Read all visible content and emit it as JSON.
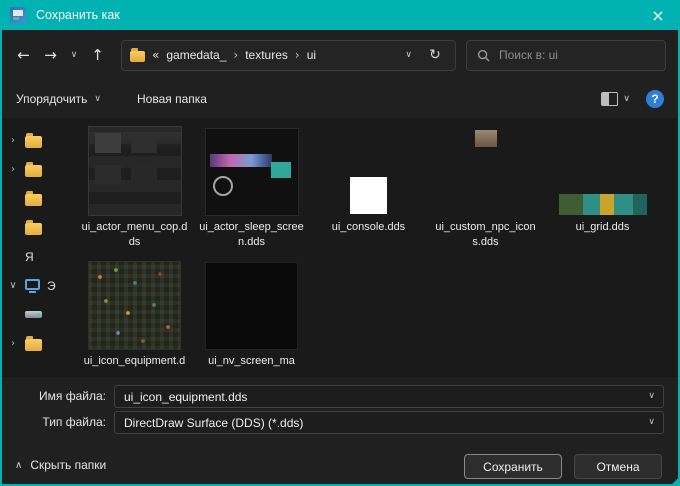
{
  "window": {
    "title": "Сохранить как"
  },
  "glyphs": {
    "close": "×",
    "back": "←",
    "forward": "→",
    "up": "↑",
    "chevron_down": "∨",
    "chevron_right": "›",
    "chevron_up": "∧",
    "overflow": "«",
    "refresh": "↻",
    "help": "?"
  },
  "nav": {
    "breadcrumb": {
      "crumbs": [
        "gamedata_",
        "textures",
        "ui"
      ],
      "separator": "›"
    },
    "search_placeholder": "Поиск в: ui"
  },
  "toolbar": {
    "organize_label": "Упорядочить",
    "new_folder_label": "Новая папка"
  },
  "sidebar": {
    "labels": {
      "ya": "Я",
      "e": "Э"
    }
  },
  "files": [
    {
      "name": "ui_actor_menu_cop.dds"
    },
    {
      "name": "ui_actor_sleep_screen.dds"
    },
    {
      "name": "ui_console.dds"
    },
    {
      "name": "ui_custom_npc_icons.dds"
    },
    {
      "name": "ui_grid.dds"
    },
    {
      "name": "ui_icon_equipment.dds"
    },
    {
      "name": "ui_nv_screen_ma"
    }
  ],
  "fields": {
    "filename_label": "Имя файла:",
    "filename_value": "ui_icon_equipment.dds",
    "filetype_label": "Тип файла:",
    "filetype_value": "DirectDraw Surface (DDS) (*.dds)"
  },
  "footer": {
    "hide_folders_label": "Скрыть папки",
    "save_label": "Сохранить",
    "cancel_label": "Отмена"
  },
  "colors": {
    "accent_teal": "#00b2b2",
    "help_blue": "#2f7fd6",
    "folder_yellow": "#e3ab3f"
  }
}
